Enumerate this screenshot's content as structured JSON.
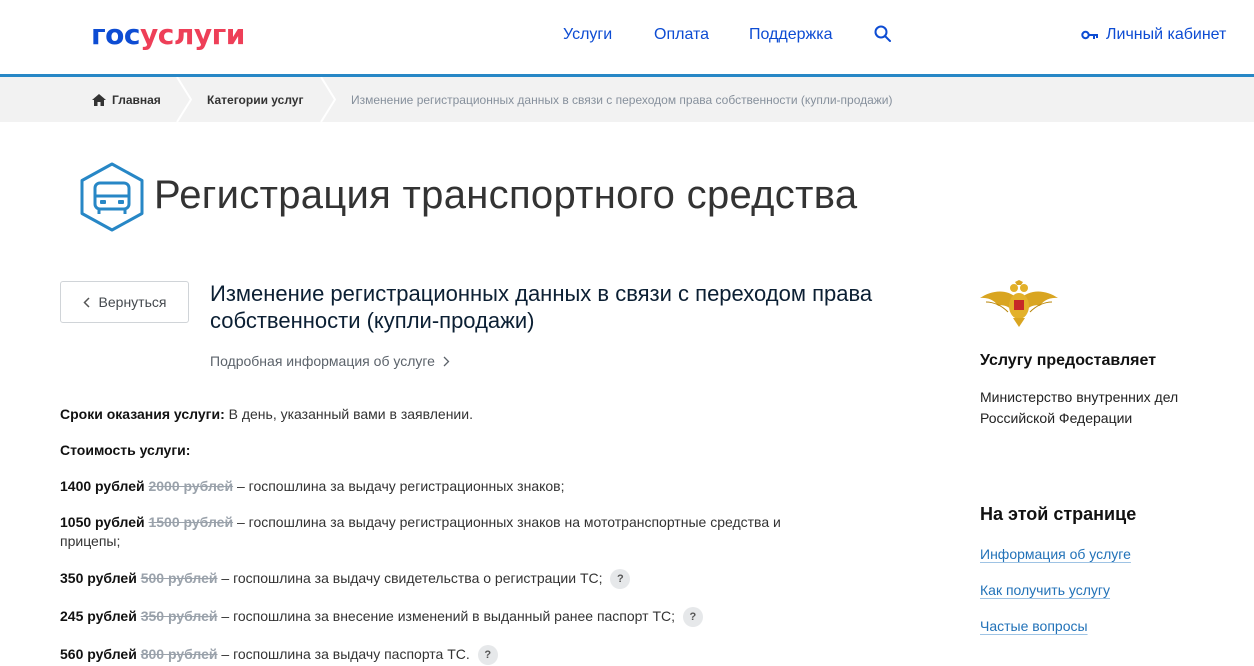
{
  "header": {
    "logo_part1": "гос",
    "logo_part2": "услуги",
    "nav": [
      "Услуги",
      "Оплата",
      "Поддержка"
    ],
    "cabinet": "Личный кабинет"
  },
  "breadcrumbs": {
    "home": "Главная",
    "categories": "Категории услуг",
    "current": "Изменение регистрационных данных в связи с переходом права собственности (купли-продажи)"
  },
  "page_title": "Регистрация транспортного средства",
  "back_button": "Вернуться",
  "service": {
    "title": "Изменение регистрационных данных в связи с переходом права собственности (купли-продажи)",
    "details_link": "Подробная информация об услуге"
  },
  "terms": {
    "label": "Сроки оказания услуги:",
    "value": "В день, указанный вами в заявлении."
  },
  "cost_label": "Стоимость услуги:",
  "fees": [
    {
      "price": "1400 рублей",
      "old": "2000 рублей",
      "desc": "– госпошлина за выдачу регистрационных знаков;"
    },
    {
      "price": "1050 рублей",
      "old": "1500 рублей",
      "desc": "– госпошлина за выдачу регистрационных знаков на мототранспортные средства и",
      "desc2": "прицепы;"
    },
    {
      "price": "350 рублей",
      "old": "500 рублей",
      "desc": "– госпошлина за выдачу свидетельства о регистрации ТС;",
      "help": "?"
    },
    {
      "price": "245 рублей",
      "old": "350 рублей",
      "desc": "– госпошлина за внесение изменений в выданный ранее паспорт ТС;",
      "help": "?"
    },
    {
      "price": "560 рублей",
      "old": "800 рублей",
      "desc": "– госпошлина за выдачу паспорта ТС.",
      "help": "?"
    }
  ],
  "sidebar": {
    "provider_heading": "Услугу предоставляет",
    "provider_line1": "Министерство внутренних дел",
    "provider_line2": "Российской Федерации",
    "on_page_heading": "На этой странице",
    "links": [
      "Информация об услуге",
      "Как получить услугу",
      "Частые вопросы"
    ]
  },
  "colors": {
    "brand_blue": "#0d4cd3",
    "brand_red": "#ee3f58",
    "header_line": "#2787c6",
    "link": "#2272b8"
  }
}
